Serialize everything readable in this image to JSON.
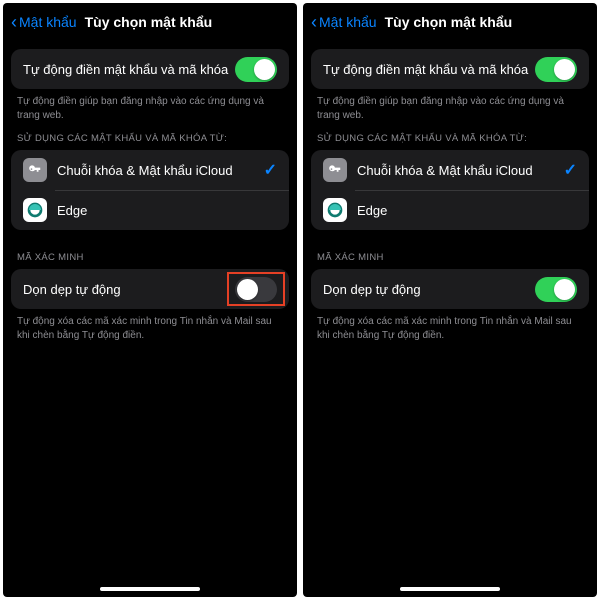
{
  "phones": [
    {
      "nav": {
        "back": "Mật khẩu",
        "title": "Tùy chọn mật khẩu"
      },
      "autofill": {
        "label": "Tự động điền mật khẩu và mã khóa",
        "on": true,
        "footer": "Tự động điền giúp bạn đăng nhập vào các ứng dụng và trang web."
      },
      "sources": {
        "header": "SỬ DỤNG CÁC MẬT KHẨU VÀ MÃ KHÓA TỪ:",
        "items": [
          {
            "label": "Chuỗi khóa & Mật khẩu iCloud",
            "icon": "keychain",
            "checked": true
          },
          {
            "label": "Edge",
            "icon": "edge",
            "checked": false
          }
        ]
      },
      "cleanup": {
        "header": "MÃ XÁC MINH",
        "label": "Dọn dẹp tự động",
        "on": false,
        "highlight": true,
        "footer": "Tự động xóa các mã xác minh trong Tin nhắn và Mail sau khi chèn bằng Tự động điền."
      }
    },
    {
      "nav": {
        "back": "Mật khẩu",
        "title": "Tùy chọn mật khẩu"
      },
      "autofill": {
        "label": "Tự động điền mật khẩu và mã khóa",
        "on": true,
        "footer": "Tự động điền giúp bạn đăng nhập vào các ứng dụng và trang web."
      },
      "sources": {
        "header": "SỬ DỤNG CÁC MẬT KHẨU VÀ MÃ KHÓA TỪ:",
        "items": [
          {
            "label": "Chuỗi khóa & Mật khẩu iCloud",
            "icon": "keychain",
            "checked": true
          },
          {
            "label": "Edge",
            "icon": "edge",
            "checked": false
          }
        ]
      },
      "cleanup": {
        "header": "MÃ XÁC MINH",
        "label": "Dọn dẹp tự động",
        "on": true,
        "highlight": false,
        "footer": "Tự động xóa các mã xác minh trong Tin nhắn và Mail sau khi chèn bằng Tự động điền."
      }
    }
  ]
}
